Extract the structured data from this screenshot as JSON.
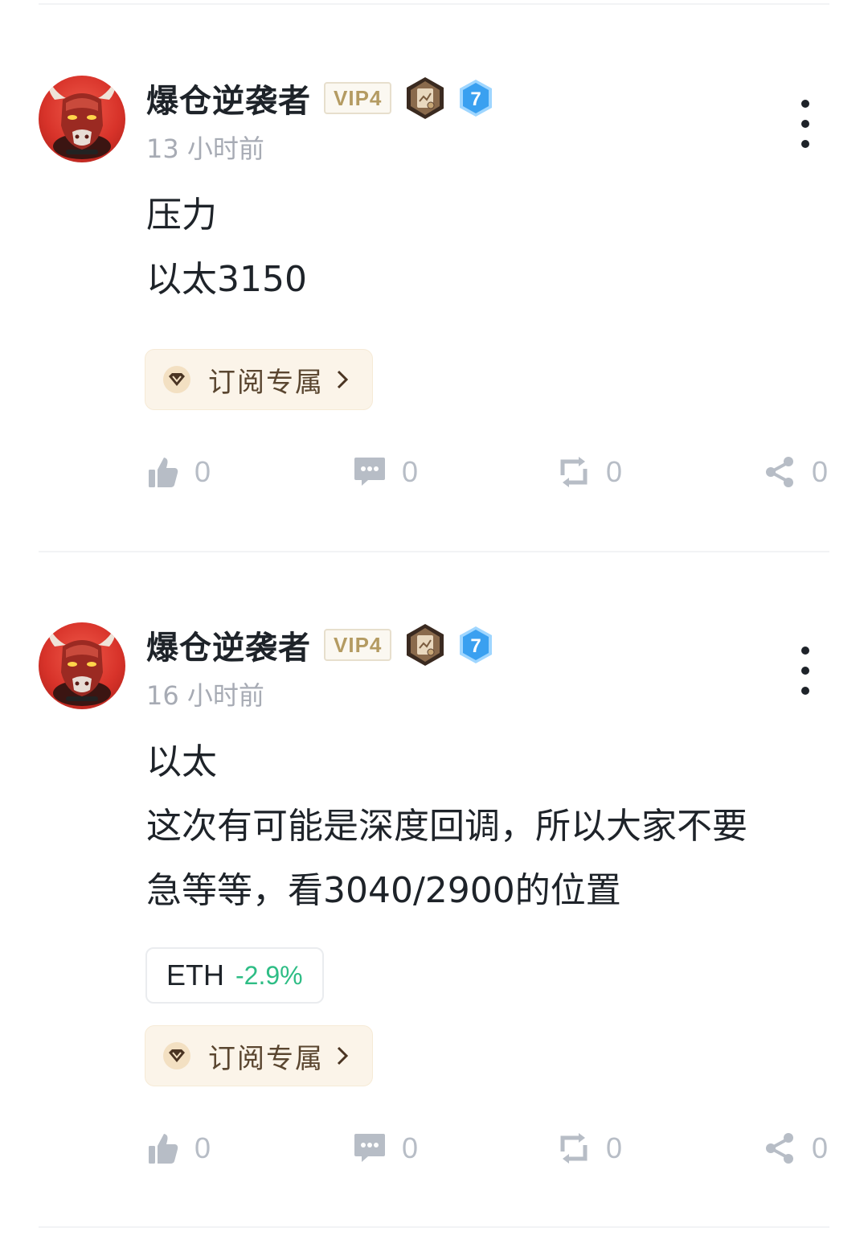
{
  "posts": [
    {
      "username": "爆仓逆袭者",
      "vip": "VIP4",
      "level": "7",
      "time": "13 小时前",
      "lines": [
        "压力",
        "以太3150"
      ],
      "subscribe_label": "订阅专属",
      "counts": {
        "like": "0",
        "comment": "0",
        "repost": "0",
        "share": "0"
      }
    },
    {
      "username": "爆仓逆袭者",
      "vip": "VIP4",
      "level": "7",
      "time": "16 小时前",
      "lines": [
        "以太",
        "这次有可能是深度回调，所以大家不要",
        "急等等，看3040/2900的位置"
      ],
      "ticker": {
        "symbol": "ETH",
        "change": "-2.9%"
      },
      "subscribe_label": "订阅专属",
      "counts": {
        "like": "0",
        "comment": "0",
        "repost": "0",
        "share": "0"
      }
    }
  ],
  "colors": {
    "vip_gold": "#b49b62",
    "level_blue": "#3aa0f0",
    "negative_change": "#2ebd85",
    "count_grey": "#b7bdc6"
  },
  "icons": {
    "like": "thumbs-up-icon",
    "comment": "comment-icon",
    "repost": "repost-icon",
    "share": "share-icon",
    "more": "more-vertical-icon",
    "subscribe": "diamond-icon"
  }
}
